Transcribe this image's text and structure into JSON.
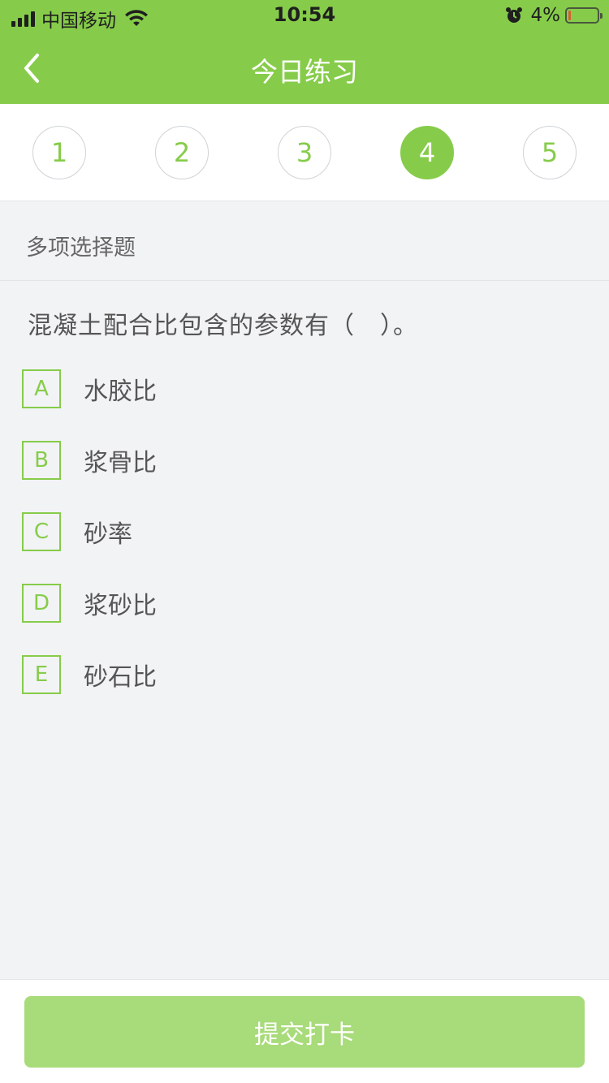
{
  "status_bar": {
    "carrier": "中国移动",
    "time": "10:54",
    "battery": "4%"
  },
  "nav": {
    "title": "今日练习",
    "back_icon": "chevron-left-icon"
  },
  "steps": [
    {
      "label": "1",
      "active": false
    },
    {
      "label": "2",
      "active": false
    },
    {
      "label": "3",
      "active": false
    },
    {
      "label": "4",
      "active": true
    },
    {
      "label": "5",
      "active": false
    }
  ],
  "question": {
    "type": "多项选择题",
    "text": "混凝土配合比包含的参数有（　）。",
    "options": [
      {
        "key": "A",
        "text": "水胶比"
      },
      {
        "key": "B",
        "text": "浆骨比"
      },
      {
        "key": "C",
        "text": "砂率"
      },
      {
        "key": "D",
        "text": "浆砂比"
      },
      {
        "key": "E",
        "text": "砂石比"
      }
    ]
  },
  "footer": {
    "submit_label": "提交打卡"
  },
  "colors": {
    "accent": "#86cc4a",
    "button": "#a8db79",
    "background": "#f2f3f5"
  }
}
